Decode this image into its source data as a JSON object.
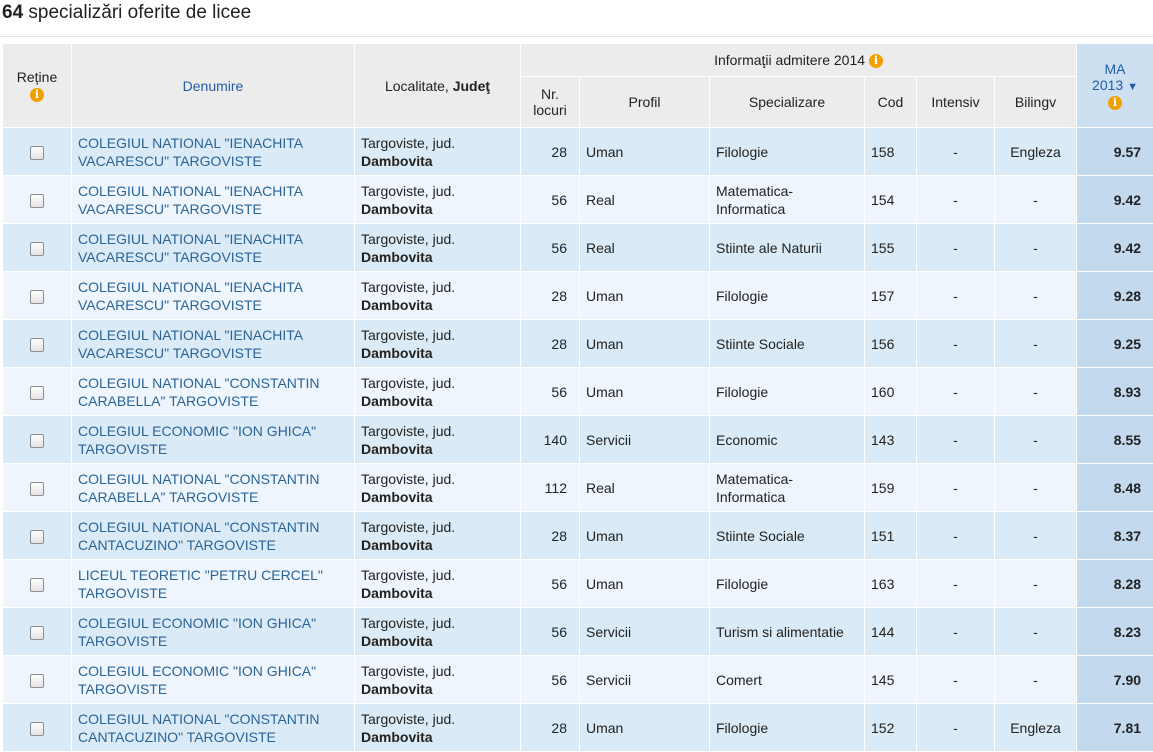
{
  "header": {
    "count": "64",
    "title_text": " specializări oferite de licee"
  },
  "table": {
    "columns": {
      "retine": "Reține",
      "denumire": "Denumire",
      "localitate": "Localitate, ",
      "judet": "Judeţ",
      "group_admitere": "Informaţii admitere 2014",
      "nr_locuri_1": "Nr.",
      "nr_locuri_2": "locuri",
      "profil": "Profil",
      "specializare": "Specializare",
      "cod": "Cod",
      "intensiv": "Intensiv",
      "bilingv": "Bilingv",
      "ma_1": "MA",
      "ma_2": "2013",
      "sort_icon": "▼"
    },
    "rows": [
      {
        "name1": "COLEGIUL NATIONAL \"IENACHITA",
        "name2": "VACARESCU\" TARGOVISTE",
        "loc": "Targoviste, jud.",
        "judet": "Dambovita",
        "locuri": "28",
        "profil": "Uman",
        "spec1": "Filologie",
        "spec2": "",
        "cod": "158",
        "intensiv": "-",
        "bilingv": "Engleza",
        "ma": "9.57"
      },
      {
        "name1": "COLEGIUL NATIONAL \"IENACHITA",
        "name2": "VACARESCU\" TARGOVISTE",
        "loc": "Targoviste, jud.",
        "judet": "Dambovita",
        "locuri": "56",
        "profil": "Real",
        "spec1": "Matematica-",
        "spec2": "Informatica",
        "cod": "154",
        "intensiv": "-",
        "bilingv": "-",
        "ma": "9.42"
      },
      {
        "name1": "COLEGIUL NATIONAL \"IENACHITA",
        "name2": "VACARESCU\" TARGOVISTE",
        "loc": "Targoviste, jud.",
        "judet": "Dambovita",
        "locuri": "56",
        "profil": "Real",
        "spec1": "Stiinte ale Naturii",
        "spec2": "",
        "cod": "155",
        "intensiv": "-",
        "bilingv": "-",
        "ma": "9.42"
      },
      {
        "name1": "COLEGIUL NATIONAL \"IENACHITA",
        "name2": "VACARESCU\" TARGOVISTE",
        "loc": "Targoviste, jud.",
        "judet": "Dambovita",
        "locuri": "28",
        "profil": "Uman",
        "spec1": "Filologie",
        "spec2": "",
        "cod": "157",
        "intensiv": "-",
        "bilingv": "-",
        "ma": "9.28"
      },
      {
        "name1": "COLEGIUL NATIONAL \"IENACHITA",
        "name2": "VACARESCU\" TARGOVISTE",
        "loc": "Targoviste, jud.",
        "judet": "Dambovita",
        "locuri": "28",
        "profil": "Uman",
        "spec1": "Stiinte Sociale",
        "spec2": "",
        "cod": "156",
        "intensiv": "-",
        "bilingv": "-",
        "ma": "9.25"
      },
      {
        "name1": "COLEGIUL NATIONAL \"CONSTANTIN",
        "name2": "CARABELLA\" TARGOVISTE",
        "loc": "Targoviste, jud.",
        "judet": "Dambovita",
        "locuri": "56",
        "profil": "Uman",
        "spec1": "Filologie",
        "spec2": "",
        "cod": "160",
        "intensiv": "-",
        "bilingv": "-",
        "ma": "8.93"
      },
      {
        "name1": "COLEGIUL ECONOMIC \"ION GHICA\"",
        "name2": "TARGOVISTE",
        "loc": "Targoviste, jud.",
        "judet": "Dambovita",
        "locuri": "140",
        "profil": "Servicii",
        "spec1": "Economic",
        "spec2": "",
        "cod": "143",
        "intensiv": "-",
        "bilingv": "-",
        "ma": "8.55"
      },
      {
        "name1": "COLEGIUL NATIONAL \"CONSTANTIN",
        "name2": "CARABELLA\" TARGOVISTE",
        "loc": "Targoviste, jud.",
        "judet": "Dambovita",
        "locuri": "112",
        "profil": "Real",
        "spec1": "Matematica-",
        "spec2": "Informatica",
        "cod": "159",
        "intensiv": "-",
        "bilingv": "-",
        "ma": "8.48"
      },
      {
        "name1": "COLEGIUL NATIONAL \"CONSTANTIN",
        "name2": "CANTACUZINO\" TARGOVISTE",
        "loc": "Targoviste, jud.",
        "judet": "Dambovita",
        "locuri": "28",
        "profil": "Uman",
        "spec1": "Stiinte Sociale",
        "spec2": "",
        "cod": "151",
        "intensiv": "-",
        "bilingv": "-",
        "ma": "8.37"
      },
      {
        "name1": "LICEUL TEORETIC \"PETRU CERCEL\"",
        "name2": "TARGOVISTE",
        "loc": "Targoviste, jud.",
        "judet": "Dambovita",
        "locuri": "56",
        "profil": "Uman",
        "spec1": "Filologie",
        "spec2": "",
        "cod": "163",
        "intensiv": "-",
        "bilingv": "-",
        "ma": "8.28"
      },
      {
        "name1": "COLEGIUL ECONOMIC \"ION GHICA\"",
        "name2": "TARGOVISTE",
        "loc": "Targoviste, jud.",
        "judet": "Dambovita",
        "locuri": "56",
        "profil": "Servicii",
        "spec1": "Turism si alimentatie",
        "spec2": "",
        "cod": "144",
        "intensiv": "-",
        "bilingv": "-",
        "ma": "8.23"
      },
      {
        "name1": "COLEGIUL ECONOMIC \"ION GHICA\"",
        "name2": "TARGOVISTE",
        "loc": "Targoviste, jud.",
        "judet": "Dambovita",
        "locuri": "56",
        "profil": "Servicii",
        "spec1": "Comert",
        "spec2": "",
        "cod": "145",
        "intensiv": "-",
        "bilingv": "-",
        "ma": "7.90"
      },
      {
        "name1": "COLEGIUL NATIONAL \"CONSTANTIN",
        "name2": "CANTACUZINO\" TARGOVISTE",
        "loc": "Targoviste, jud.",
        "judet": "Dambovita",
        "locuri": "28",
        "profil": "Uman",
        "spec1": "Filologie",
        "spec2": "",
        "cod": "152",
        "intensiv": "-",
        "bilingv": "Engleza",
        "ma": "7.81"
      }
    ]
  },
  "icons": {
    "info": "info-icon",
    "checkbox": "checkbox-icon"
  },
  "colors": {
    "link": "#2a6496",
    "row_odd": "#daeaf7",
    "row_even": "#eef5fc",
    "ma_col": "#c2d9ee",
    "info_icon": "#f0a000"
  }
}
